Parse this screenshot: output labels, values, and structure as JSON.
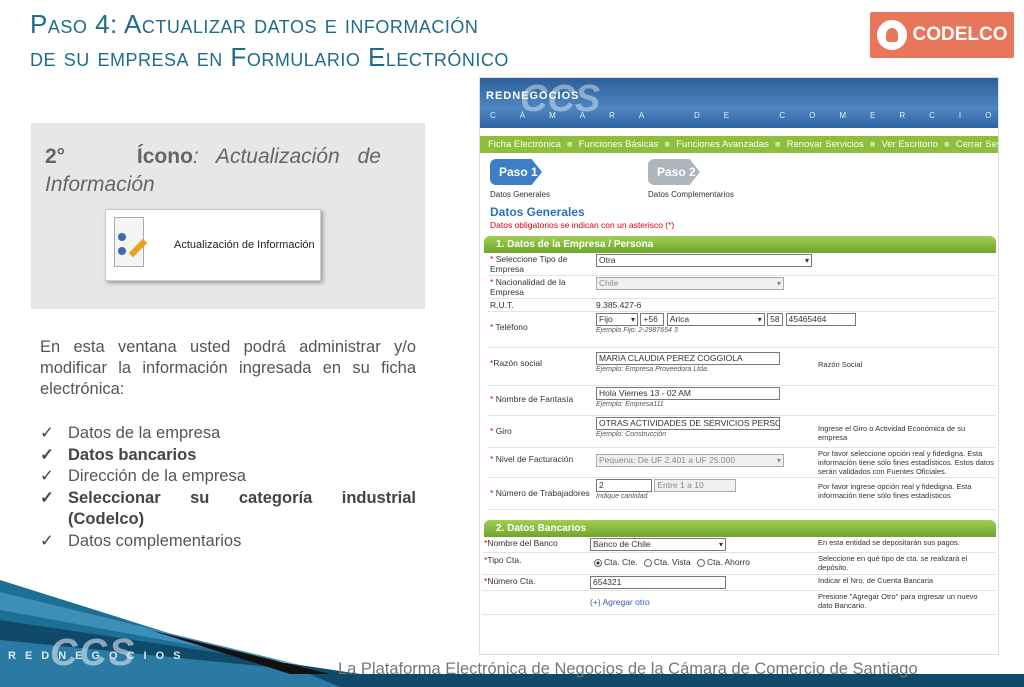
{
  "slide": {
    "title_line1": "Paso 4: Actualizar datos e información",
    "title_line2": "de su empresa en Formulario Electrónico",
    "logo_text": "CODELCO",
    "icon_box": {
      "prefix": "2°",
      "bold": "Ícono",
      "rest": ": Actualización de Información",
      "card_label": "Actualización de Información"
    },
    "body": "En esta ventana usted podrá administrar y/o modificar la información ingresada en su ficha electrónica:",
    "bullets": [
      {
        "text": "Datos de la empresa",
        "bold": false
      },
      {
        "text": "Datos bancarios",
        "bold": true
      },
      {
        "text": "Dirección de la empresa",
        "bold": false
      },
      {
        "text": "Seleccionar su categoría industrial (Codelco)",
        "bold": true
      },
      {
        "text": "Datos complementarios",
        "bold": false
      }
    ],
    "footer_text": "La Plataforma Electrónica de Negocios de la Cámara de Comercio de Santiago",
    "footer_logo_small": "REDNEGOCIOS",
    "footer_logo_big": "CCS"
  },
  "web": {
    "brand": "REDNEGOCIOS",
    "ccs": "CCS",
    "subtitle": "CÁMARA DE COMERCIO DE SANTIAGO",
    "nav": [
      "Ficha Electrónica",
      "Funciones Básicas",
      "Funciones Avanzadas",
      "Renovar Servicios",
      "Ver Escritorio",
      "Cerrar Sesión"
    ],
    "step1": {
      "label": "Paso 1",
      "desc": "Datos Generales"
    },
    "step2": {
      "label": "Paso 2",
      "desc": "Datos Complementarios"
    },
    "section_title": "Datos Generales",
    "section_note": "Datos obligatorios se indican con un asterisco (*)",
    "bar1": "1. Datos de la Empresa / Persona",
    "fields": {
      "tipo_label": "Seleccione Tipo de Empresa",
      "tipo_value": "Otra",
      "nac_label": "Nacionalidad de la Empresa",
      "nac_value": "Chile",
      "rut_label": "R.U.T.",
      "rut_value": "9.385.427-6",
      "tel_label": "Teléfono",
      "tel_type": "Fijo",
      "tel_country": "+56",
      "tel_city": "Arica",
      "tel_area": "58",
      "tel_number": "45465464",
      "tel_example": "Ejemplo Fijo: 2-2987654 3",
      "razon_label": "Razón social",
      "razon_value": "MARIA CLAUDIA PEREZ COGGIOLA",
      "razon_example": "Ejemplo: Empresa Proveedora Ltda.",
      "razon_hint": "Razón Social",
      "fantasia_label": "Nombre de Fantasía",
      "fantasia_value": "Hola Viernes 13 - 02 AM",
      "fantasia_example": "Ejemplo: Empresa111",
      "giro_label": "Giro",
      "giro_value": "OTRAS ACTIVIDADES DE SERVICIOS PERSONA",
      "giro_example": "Ejemplo: Construcción",
      "giro_hint": "Ingrese el Giro o Actividad Económica de su empresa",
      "fact_label": "Nivel de Facturación",
      "fact_value": "Pequena: De UF 2.401 a UF 25.000",
      "fact_hint": "Por favor seleccione opción real y fidedigna. Esta información tiene sólo fines estadísticos. Estos datos serán validados con Fuentes Oficiales.",
      "trab_label": "Número de Trabajadores",
      "trab_value": "2",
      "trab_range": "Entre 1 a 10",
      "trab_example": "Indique cantidad",
      "trab_hint": "Por favor ingrese opción real y fidedigna. Esta información tiene sólo fines estadísticos"
    },
    "bar2": "2. Datos Bancarios",
    "bank": {
      "nombre_label": "Nombre del Banco",
      "nombre_value": "Banco de Chile",
      "nombre_hint": "En esta entidad se depositarán sus pagos.",
      "tipo_label": "Tipo Cta.",
      "tipo_options": [
        "Cta. Cte.",
        "Cta. Vista",
        "Cta. Ahorro"
      ],
      "tipo_hint": "Seleccione en qué tipo de cta. se realizará el depósito.",
      "numero_label": "Número Cta.",
      "numero_value": "654321",
      "numero_hint": "Indicar el Nro. de Cuenta Bancaria",
      "agregar": "(+) Agregar otro",
      "agregar_hint": "Presione \"Agregar Otro\" para ingresar un nuevo dato Bancario."
    }
  }
}
